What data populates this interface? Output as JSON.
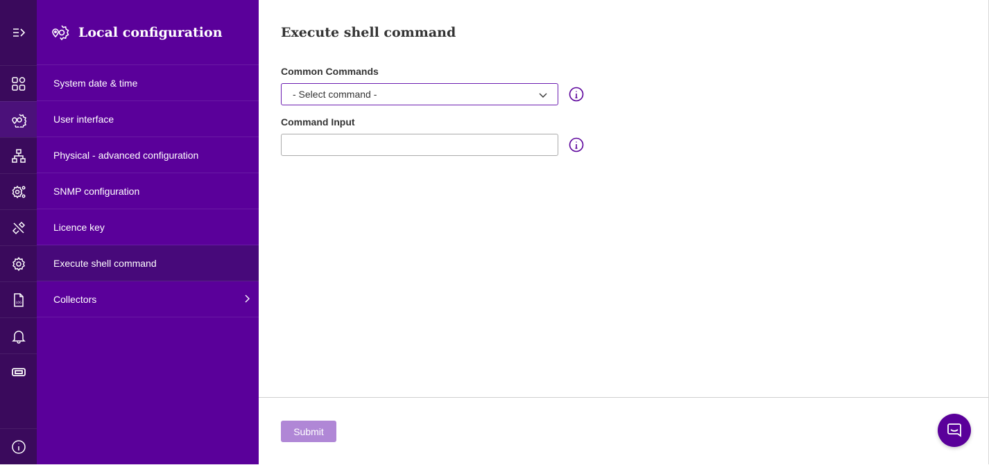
{
  "sidebar": {
    "title": "Local configuration",
    "items": [
      {
        "label": "System date & time"
      },
      {
        "label": "User interface"
      },
      {
        "label": "Physical - advanced configuration"
      },
      {
        "label": "SNMP configuration"
      },
      {
        "label": "Licence key"
      },
      {
        "label": "Execute shell command",
        "active": true
      },
      {
        "label": "Collectors",
        "has_children": true
      }
    ]
  },
  "rail": {
    "icons": [
      "menu-expand-icon",
      "dashboard-grid-icon",
      "location-settings-icon",
      "network-icon",
      "settings-share-icon",
      "tools-icon",
      "gear-icon",
      "log-file-icon",
      "bell-icon",
      "ticket-icon",
      "info-icon"
    ]
  },
  "main": {
    "title": "Execute shell command",
    "common_commands": {
      "label": "Common Commands",
      "selected": "- Select command -"
    },
    "command_input": {
      "label": "Command Input",
      "value": ""
    },
    "submit_label": "Submit"
  },
  "colors": {
    "rail": "#3a0a5c",
    "sidebar": "#5a009a",
    "accent": "#6a1bb0",
    "submit_disabled": "#b087d6"
  }
}
